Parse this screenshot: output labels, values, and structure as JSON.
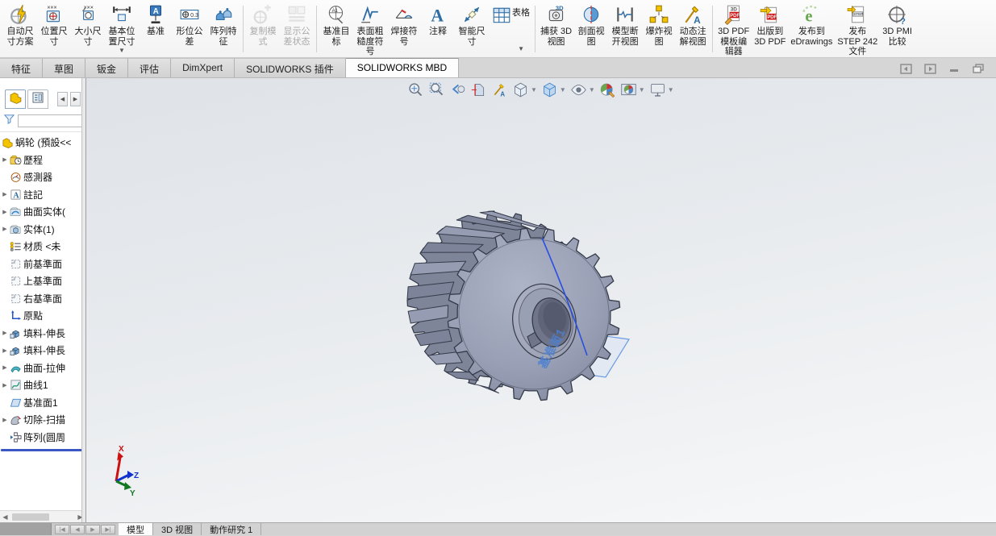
{
  "ribbon": {
    "items": [
      {
        "name": "auto-dim-scheme",
        "label": "自动尺\n寸方案",
        "icon": "auto-dim"
      },
      {
        "name": "location-dimension",
        "label": "位置尺\n寸",
        "icon": "loc-dim"
      },
      {
        "name": "size-dimension",
        "label": "大小尺\n寸",
        "icon": "size-dim"
      },
      {
        "name": "basic-location-dimension",
        "label": "基本位\n置尺寸",
        "icon": "basic-dim",
        "arrow": true
      },
      {
        "name": "datum",
        "label": "基准",
        "icon": "datum"
      },
      {
        "name": "geometric-tolerance",
        "label": "形位公\n差",
        "icon": "gtol"
      },
      {
        "name": "pattern-feature",
        "label": "阵列特\n征",
        "icon": "pattern-feat"
      },
      {
        "sep": true
      },
      {
        "name": "copy-scheme",
        "label": "复制模\n式",
        "icon": "copy-scheme",
        "disabled": true
      },
      {
        "name": "show-tolerance-status",
        "label": "显示公\n差状态",
        "icon": "tol-status",
        "disabled": true
      },
      {
        "sep": true
      },
      {
        "name": "datum-target",
        "label": "基准目\n标",
        "icon": "datum-target"
      },
      {
        "name": "surface-finish-symbol",
        "label": "表面粗\n糙度符\n号",
        "icon": "surface-finish"
      },
      {
        "name": "weld-symbol",
        "label": "焊接符\n号",
        "icon": "weld-symbol"
      },
      {
        "name": "note",
        "label": "注释",
        "icon": "note"
      },
      {
        "name": "smart-dimension",
        "label": "智能尺\n寸",
        "icon": "smart-dim"
      },
      {
        "name": "tables",
        "label": "表格",
        "icon": "table",
        "arrow": true,
        "side": true
      },
      {
        "sep": true
      },
      {
        "name": "capture-3d-view",
        "label": "捕获 3D\n视图",
        "icon": "capture-3d"
      },
      {
        "name": "section-view",
        "label": "剖面视\n图",
        "icon": "section-view"
      },
      {
        "name": "model-break-view",
        "label": "模型断\n开视图",
        "icon": "break-view"
      },
      {
        "name": "exploded-view",
        "label": "爆炸视\n图",
        "icon": "exploded-view"
      },
      {
        "name": "dynamic-annotation-views",
        "label": "动态注\n解视图",
        "icon": "dyn-annot"
      },
      {
        "sep": true
      },
      {
        "name": "3d-pdf-template-editor",
        "label": "3D PDF\n模板编\n辑器",
        "icon": "pdf-template"
      },
      {
        "name": "publish-to-3d-pdf",
        "label": "出版到\n3D PDF",
        "icon": "pub-3dpdf"
      },
      {
        "name": "publish-to-edrawings",
        "label": "发布到\neDrawings",
        "icon": "edrawings"
      },
      {
        "name": "publish-step-242",
        "label": "发布\nSTEP 242\n文件",
        "icon": "step242"
      },
      {
        "name": "3d-pmi-compare",
        "label": "3D PMI\n比较",
        "icon": "pmi-compare"
      }
    ]
  },
  "command_tabs": {
    "active": "SOLIDWORKS MBD",
    "items": [
      {
        "name": "features",
        "label": "特征"
      },
      {
        "name": "sketch",
        "label": "草图"
      },
      {
        "name": "sheet-metal",
        "label": "钣金"
      },
      {
        "name": "evaluate",
        "label": "评估"
      },
      {
        "name": "dimxpert",
        "label": "DimXpert"
      },
      {
        "name": "solidworks-add-ins",
        "label": "SOLIDWORKS 插件"
      },
      {
        "name": "solidworks-mbd",
        "label": "SOLIDWORKS MBD"
      }
    ]
  },
  "feature_tree": {
    "filter_value": "",
    "root": "蜗轮 (預設<<",
    "items": [
      {
        "name": "history",
        "label": "歷程",
        "icon": "history",
        "caret": true
      },
      {
        "name": "sensors",
        "label": "感測器",
        "icon": "sensors",
        "caret": false
      },
      {
        "name": "annotations",
        "label": "註記",
        "icon": "annotations",
        "caret": true
      },
      {
        "name": "surface-bodies",
        "label": "曲面实体(",
        "icon": "surface-bodies",
        "caret": true
      },
      {
        "name": "solid-bodies",
        "label": "实体(1)",
        "icon": "solid-bodies",
        "caret": true
      },
      {
        "name": "material",
        "label": "材质 <未",
        "icon": "material",
        "caret": false
      },
      {
        "name": "front-plane",
        "label": "前基準面",
        "icon": "plane",
        "caret": false
      },
      {
        "name": "top-plane",
        "label": "上基準面",
        "icon": "plane",
        "caret": false
      },
      {
        "name": "right-plane",
        "label": "右基準面",
        "icon": "plane",
        "caret": false
      },
      {
        "name": "origin",
        "label": "原點",
        "icon": "origin",
        "caret": false
      },
      {
        "name": "boss-extrude1",
        "label": "填料-伸長",
        "icon": "boss-extrude",
        "caret": true
      },
      {
        "name": "boss-extrude2",
        "label": "填料-伸長",
        "icon": "boss-extrude",
        "caret": true
      },
      {
        "name": "surface-extrude",
        "label": "曲面-拉伸",
        "icon": "surface-extrude",
        "caret": true
      },
      {
        "name": "curve1",
        "label": "曲线1",
        "icon": "curve",
        "caret": true
      },
      {
        "name": "plane1",
        "label": "基准面1",
        "icon": "ref-plane",
        "caret": false
      },
      {
        "name": "cut-sweep",
        "label": "切除-扫描",
        "icon": "cut-sweep",
        "caret": true
      },
      {
        "name": "circular-pattern",
        "label": "阵列(圆周",
        "icon": "circular-pattern",
        "caret": false
      }
    ]
  },
  "headsup": {
    "items": [
      {
        "name": "zoom-to-fit",
        "icon": "zoom-fit"
      },
      {
        "name": "zoom-to-area",
        "icon": "zoom-area"
      },
      {
        "name": "previous-view",
        "icon": "prev-view"
      },
      {
        "name": "section-view",
        "icon": "hud-section"
      },
      {
        "name": "dynamic-annotation-views",
        "icon": "hud-annot"
      },
      {
        "name": "view-orientation",
        "icon": "view-orient",
        "arrow": true
      },
      {
        "name": "display-style",
        "icon": "display-style",
        "arrow": true
      },
      {
        "name": "hide-show-items",
        "icon": "hide-show",
        "arrow": true
      },
      {
        "name": "edit-appearance",
        "icon": "appearance"
      },
      {
        "name": "apply-scene",
        "icon": "scene",
        "arrow": true
      },
      {
        "name": "view-settings",
        "icon": "view-settings",
        "arrow": true
      }
    ]
  },
  "viewport": {
    "plane_label": "基准面1",
    "triad": {
      "x": "X",
      "y": "Y",
      "z": "Z"
    }
  },
  "bottom_bar": {
    "tabs": [
      {
        "name": "model",
        "label": "模型",
        "active": true
      },
      {
        "name": "3d-views",
        "label": "3D 视图",
        "active": false
      },
      {
        "name": "motion-study-1",
        "label": "動作研究 1",
        "active": false
      }
    ]
  },
  "colors": {
    "curve_blue": "#2b50e0",
    "plane_blue": "#4a7fd0",
    "gear_face": "#99a0b5",
    "rollback_bar": "#3a57c4"
  }
}
